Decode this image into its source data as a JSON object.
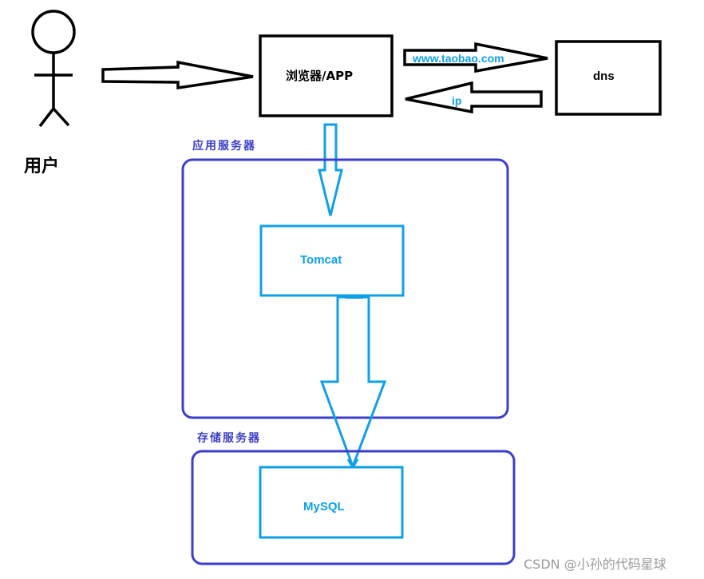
{
  "colors": {
    "black": "#000000",
    "container_border": "#3b3ec8",
    "component_blue": "#0ea0e6",
    "watermark": "#9a9a9a"
  },
  "actor": {
    "label": "用户",
    "icon": "stick-figure-user"
  },
  "nodes": {
    "browser": {
      "label": "浏览器/APP"
    },
    "dns": {
      "label": "dns"
    },
    "tomcat": {
      "label": "Tomcat"
    },
    "mysql": {
      "label": "MySQL"
    }
  },
  "containers": {
    "app_server": {
      "label": "应用服务器"
    },
    "storage_server": {
      "label": "存储服务器"
    }
  },
  "edges": {
    "user_to_browser": {
      "from": "用户",
      "to": "浏览器/APP",
      "label": ""
    },
    "browser_to_dns": {
      "from": "浏览器/APP",
      "to": "dns",
      "label": "www.taobao.com"
    },
    "dns_to_browser": {
      "from": "dns",
      "to": "浏览器/APP",
      "label": "ip"
    },
    "browser_to_tomcat": {
      "from": "浏览器/APP",
      "to": "Tomcat",
      "label": ""
    },
    "tomcat_to_mysql": {
      "from": "Tomcat",
      "to": "MySQL",
      "label": ""
    }
  },
  "watermark": "CSDN @小孙的代码星球"
}
